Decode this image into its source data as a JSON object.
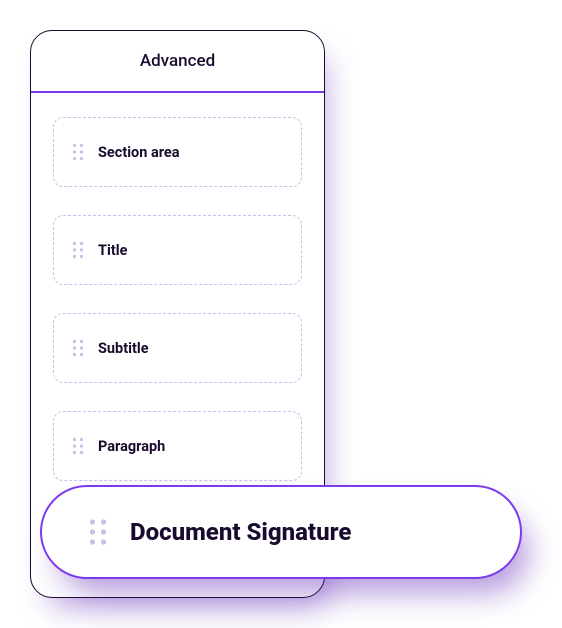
{
  "tabs": {
    "active_label": "Advanced"
  },
  "blocks": [
    {
      "label": "Section area"
    },
    {
      "label": "Title"
    },
    {
      "label": "Subtitle"
    },
    {
      "label": "Paragraph"
    }
  ],
  "feature": {
    "label": "Document Signature"
  }
}
